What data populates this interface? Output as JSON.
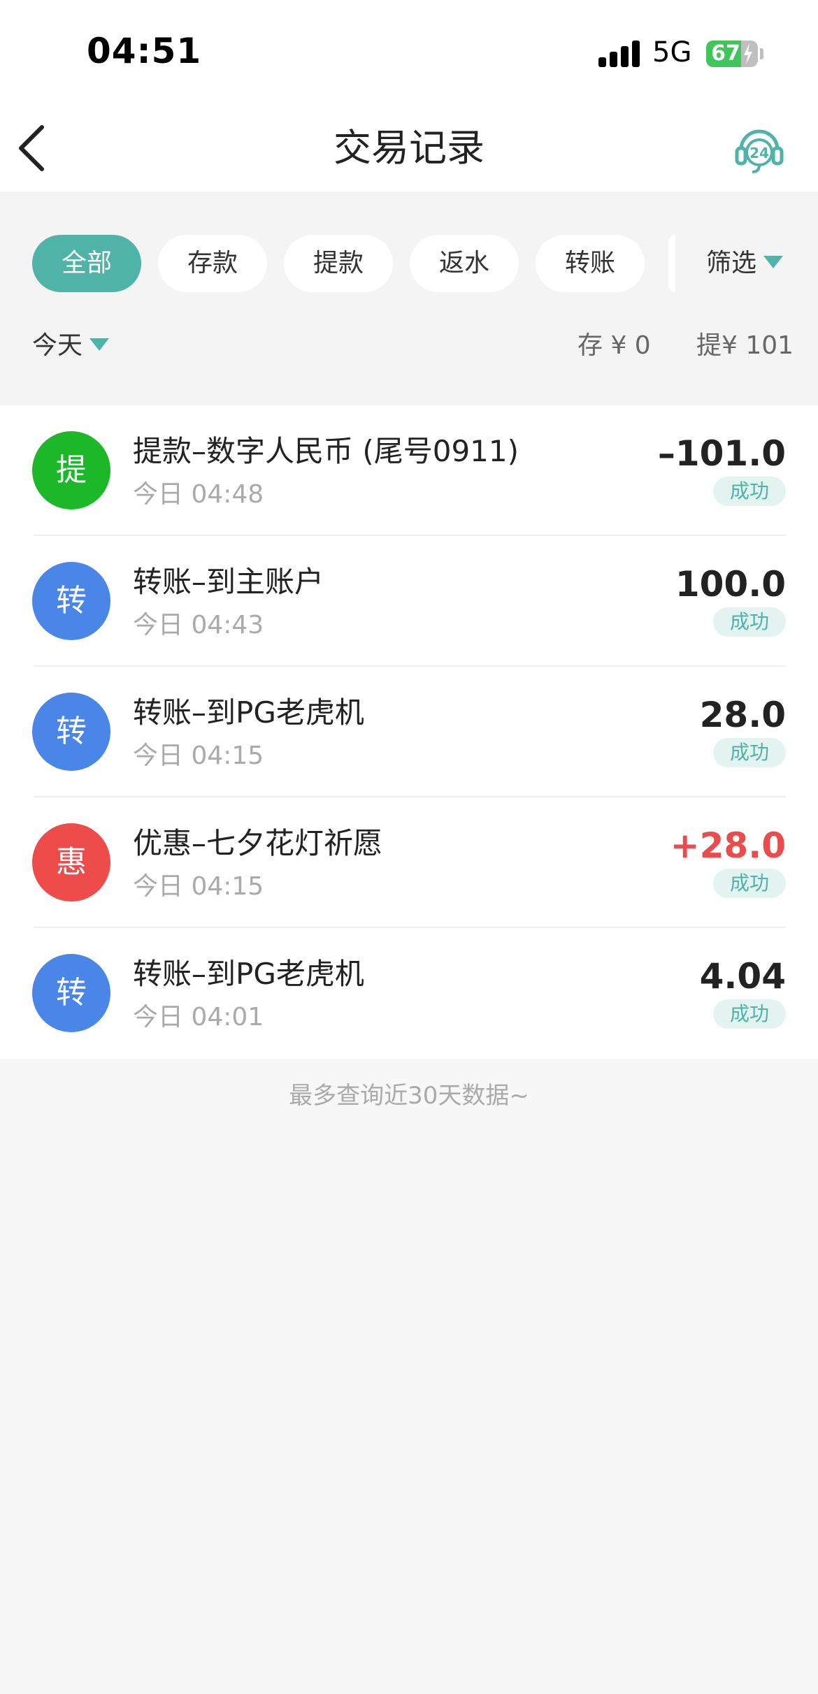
{
  "status_bar": {
    "time": "04:51",
    "network": "5G",
    "battery": "67",
    "battery_level_percent": 67
  },
  "nav": {
    "title": "交易记录",
    "back_icon": "chevron-left-icon",
    "support_icon": "headset-24-icon"
  },
  "filters": {
    "chips": [
      {
        "label": "全部",
        "active": true
      },
      {
        "label": "存款",
        "active": false
      },
      {
        "label": "提款",
        "active": false
      },
      {
        "label": "返水",
        "active": false
      },
      {
        "label": "转账",
        "active": false
      }
    ],
    "filter_label": "筛选",
    "date_label": "今天",
    "deposit_summary": "存 ¥ 0",
    "withdraw_summary": "提¥ 101"
  },
  "transactions": [
    {
      "avatar": "提",
      "avatar_color": "#1db82a",
      "title": "提款–数字人民币 (尾号0911)",
      "time": "今日 04:48",
      "amount": "–101.0",
      "type": "debit",
      "status": "成功"
    },
    {
      "avatar": "转",
      "avatar_color": "#4a86e8",
      "title": "转账–到主账户",
      "time": "今日 04:43",
      "amount": "100.0",
      "type": "neutral",
      "status": "成功"
    },
    {
      "avatar": "转",
      "avatar_color": "#4a86e8",
      "title": "转账–到PG老虎机",
      "time": "今日 04:15",
      "amount": "28.0",
      "type": "neutral",
      "status": "成功"
    },
    {
      "avatar": "惠",
      "avatar_color": "#ee4b4b",
      "title": "优惠–七夕花灯祈愿",
      "time": "今日 04:15",
      "amount": "+28.0",
      "type": "credit",
      "status": "成功"
    },
    {
      "avatar": "转",
      "avatar_color": "#4a86e8",
      "title": "转账–到PG老虎机",
      "time": "今日 04:01",
      "amount": "4.04",
      "type": "neutral",
      "status": "成功"
    }
  ],
  "footer_note": "最多查询近30天数据~",
  "colors": {
    "accent": "#4fb3a8",
    "credit": "#e84c4c",
    "battery": "#3fc55a"
  }
}
